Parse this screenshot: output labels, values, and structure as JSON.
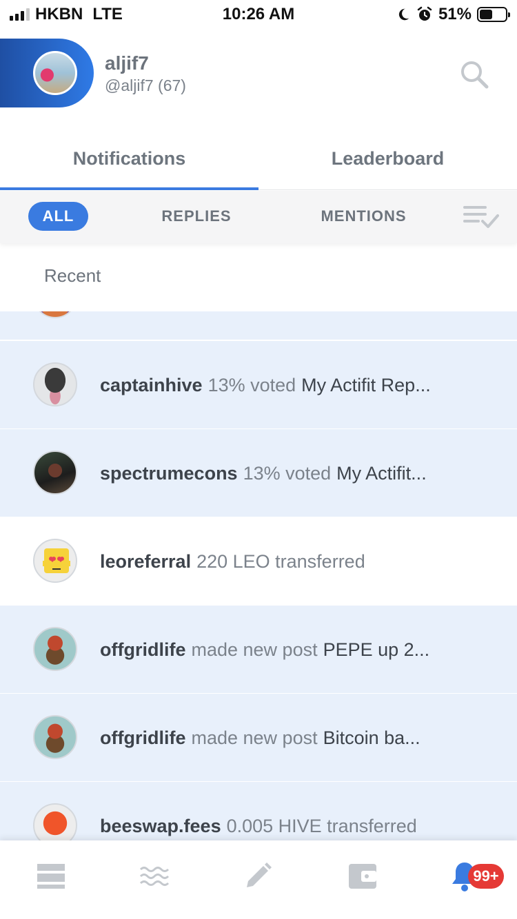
{
  "status_bar": {
    "carrier": "HKBN",
    "network": "LTE",
    "time": "10:26 AM",
    "battery": "51%",
    "battery_level": 0.51
  },
  "header": {
    "display_name": "aljif7",
    "handle": "@aljif7 (67)"
  },
  "tabs": [
    {
      "label": "Notifications",
      "active": true
    },
    {
      "label": "Leaderboard",
      "active": false
    }
  ],
  "filters": [
    {
      "label": "ALL",
      "active": true
    },
    {
      "label": "REPLIES",
      "active": false
    },
    {
      "label": "MENTIONS",
      "active": false
    }
  ],
  "section_label": "Recent",
  "notifications": [
    {
      "user": "captainhive",
      "meta": "13%  voted",
      "target": "My Actifit Rep...",
      "unread": true
    },
    {
      "user": "spectrumecons",
      "meta": "13%  voted",
      "target": "My Actifit...",
      "unread": true
    },
    {
      "user": "leoreferral",
      "meta": "220 LEO transferred",
      "target": "",
      "unread": false
    },
    {
      "user": "offgridlife",
      "meta": "made new post",
      "target": "PEPE up 2...",
      "unread": true
    },
    {
      "user": "offgridlife",
      "meta": "made new post",
      "target": "Bitcoin ba...",
      "unread": true
    },
    {
      "user": "beeswap.fees",
      "meta": "0.005 HIVE transferred",
      "target": "",
      "unread": true
    }
  ],
  "bottom_nav": {
    "icons": [
      "feed-icon",
      "waves-icon",
      "edit-icon",
      "wallet-icon",
      "bell-icon"
    ],
    "badge": "99+"
  },
  "colors": {
    "accent": "#3a7be0",
    "unread_bg": "#e8f0fb",
    "badge": "#e53935"
  }
}
